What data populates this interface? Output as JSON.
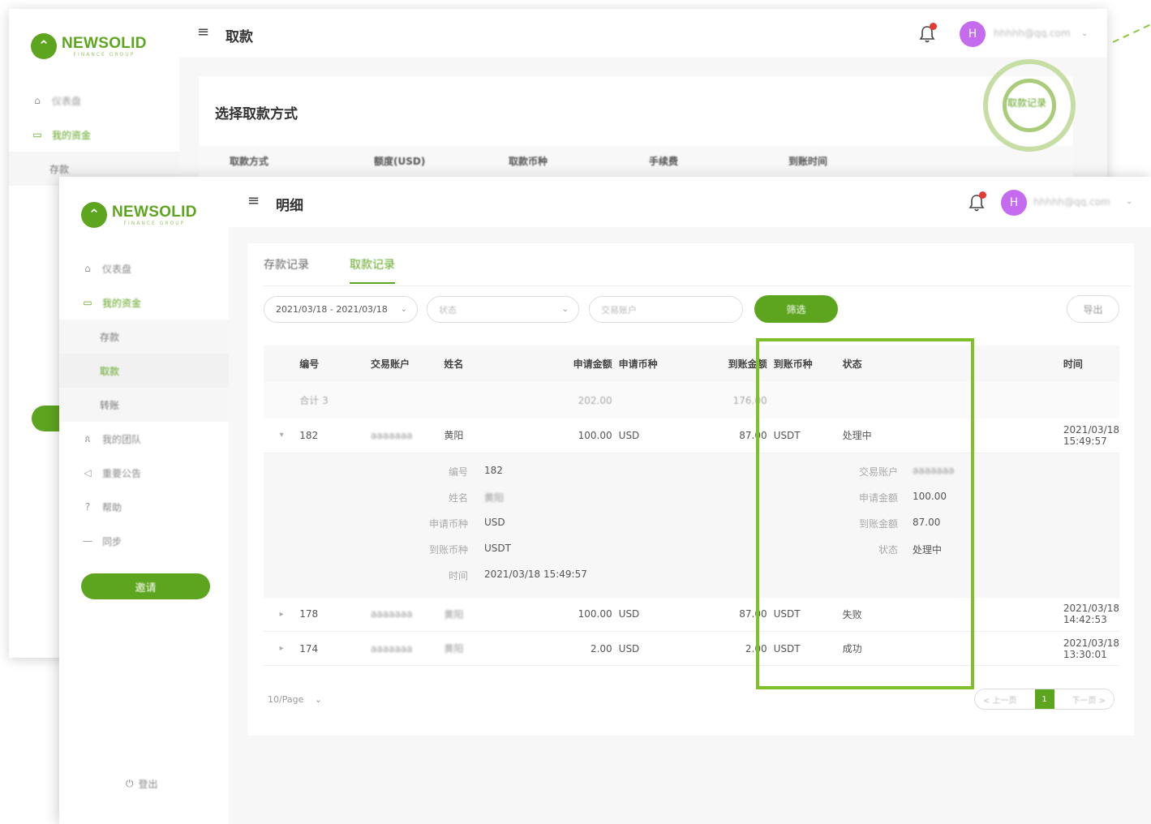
{
  "brand": {
    "name": "NEWSOLID",
    "tagline": "FINANCE GROUP"
  },
  "back_window": {
    "page_title": "取款",
    "user_email": "hhhhh@qq.com",
    "nav": [
      {
        "icon": "home-icon",
        "label": "仪表盘"
      },
      {
        "icon": "wallet-icon",
        "label": "我的资金"
      },
      {
        "label": "存款"
      }
    ],
    "card_title": "选择取款方式",
    "columns": [
      "取款方式",
      "额度(USD)",
      "取款币种",
      "手续费",
      "到账时间"
    ],
    "link": "取款记录"
  },
  "front_window": {
    "page_title": "明细",
    "user_email": "hhhhh@qq.com",
    "avatar_letter": "H",
    "nav": [
      {
        "icon": "home-icon",
        "label": "仪表盘"
      },
      {
        "icon": "wallet-icon",
        "label": "我的资金"
      }
    ],
    "subnav": [
      "存款",
      "取款",
      "转账"
    ],
    "nav2": [
      {
        "icon": "team-icon",
        "label": "我的团队"
      },
      {
        "icon": "megaphone-icon",
        "label": "重要公告"
      },
      {
        "icon": "help-icon",
        "label": "帮助"
      },
      {
        "icon": "sync-icon",
        "label": "同步"
      }
    ],
    "invite_label": "邀请",
    "logout_label": "登出",
    "tabs": [
      "存款记录",
      "取款记录"
    ],
    "filters": {
      "date_range": "2021/03/18 - 2021/03/18",
      "status_placeholder": "状态",
      "account_placeholder": "交易账户",
      "filter_button": "筛选",
      "export_button": "导出"
    },
    "table": {
      "headers": [
        "编号",
        "交易账户",
        "姓名",
        "申请金额",
        "申请币种",
        "到账金额",
        "到账币种",
        "状态",
        "时间"
      ],
      "total": {
        "label": "合计 3",
        "apply_amount": "202.00",
        "received_amount": "176.00"
      },
      "rows": [
        {
          "id": "182",
          "account": "aaaaaaa",
          "name": "黄阳",
          "amount": "100.00",
          "currency": "USD",
          "received": "87.00",
          "recv_currency": "USDT",
          "status": "处理中",
          "time": "2021/03/18 15:49:57"
        },
        {
          "id": "178",
          "account": "aaaaaaa",
          "name": "黄阳",
          "amount": "100.00",
          "currency": "USD",
          "received": "87.00",
          "recv_currency": "USDT",
          "status": "失败",
          "time": "2021/03/18 14:42:53"
        },
        {
          "id": "174",
          "account": "aaaaaaa",
          "name": "黄阳",
          "amount": "2.00",
          "currency": "USD",
          "received": "2.00",
          "recv_currency": "USDT",
          "status": "成功",
          "time": "2021/03/18 13:30:01"
        }
      ],
      "detail": {
        "id_label": "编号",
        "id": "182",
        "name_label": "姓名",
        "name": "黄阳",
        "apply_currency_label": "申请币种",
        "apply_currency": "USD",
        "recv_currency_label": "到账币种",
        "recv_currency": "USDT",
        "time_label": "时间",
        "time": "2021/03/18 15:49:57",
        "account_label": "交易账户",
        "account": "aaaaaaa",
        "apply_amount_label": "申请金额",
        "apply_amount": "100.00",
        "recv_amount_label": "到账金额",
        "recv_amount": "87.00",
        "status_label": "状态",
        "status": "处理中"
      }
    },
    "pagination": {
      "page_size": "10/Page",
      "prev": "< 上一页",
      "current": "1",
      "next": "下一页 >"
    }
  },
  "colors": {
    "accent": "#5ea51f",
    "highlight": "#7ebf2a",
    "avatar": "#c56bf0",
    "alert": "#e53935"
  }
}
